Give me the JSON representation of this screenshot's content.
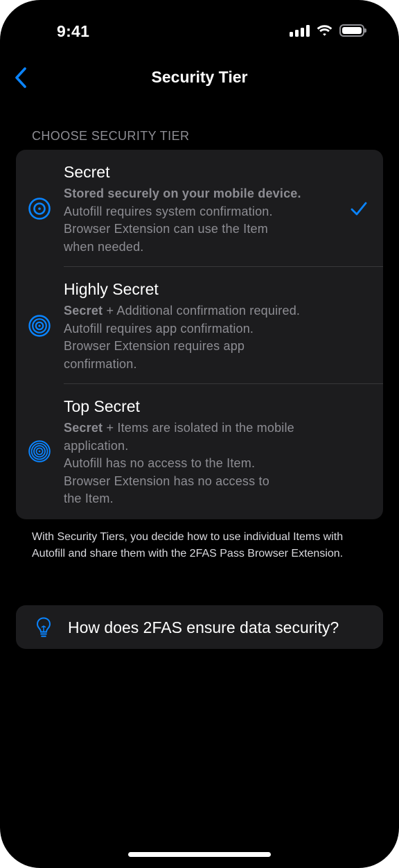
{
  "status_bar": {
    "time": "9:41"
  },
  "nav": {
    "title": "Security Tier",
    "back_icon": "chevron-left-icon"
  },
  "section": {
    "header": "CHOOSE SECURITY TIER",
    "footer": "With Security Tiers, you decide how to use individual Items with Autofill and share them with the 2FAS Pass Browser Extension."
  },
  "tiers": [
    {
      "title": "Secret",
      "icon": "secret-tier-icon",
      "selected": true,
      "lead": "Stored securely on your mobile device.",
      "lines": [
        "Autofill requires system confirmation.",
        "Browser Extension can use the Item",
        "when needed."
      ]
    },
    {
      "title": "Highly Secret",
      "icon": "highly-secret-tier-icon",
      "selected": false,
      "lead": "Secret",
      "lead_rest": " + Additional confirmation required.",
      "lines": [
        "Autofill requires app confirmation.",
        "Browser Extension requires app",
        "confirmation."
      ]
    },
    {
      "title": "Top Secret",
      "icon": "top-secret-tier-icon",
      "selected": false,
      "lead": "Secret",
      "lead_rest": " + Items are isolated in the mobile",
      "lines": [
        "application.",
        "Autofill has no access to the Item.",
        "Browser Extension has no access to",
        "the Item."
      ]
    }
  ],
  "help": {
    "label": "How does 2FAS ensure data security?",
    "icon": "lightbulb-icon"
  },
  "colors": {
    "accent": "#0a84ff",
    "background": "#000000",
    "card": "#1c1c1e",
    "secondary_text": "#8d8d93"
  }
}
